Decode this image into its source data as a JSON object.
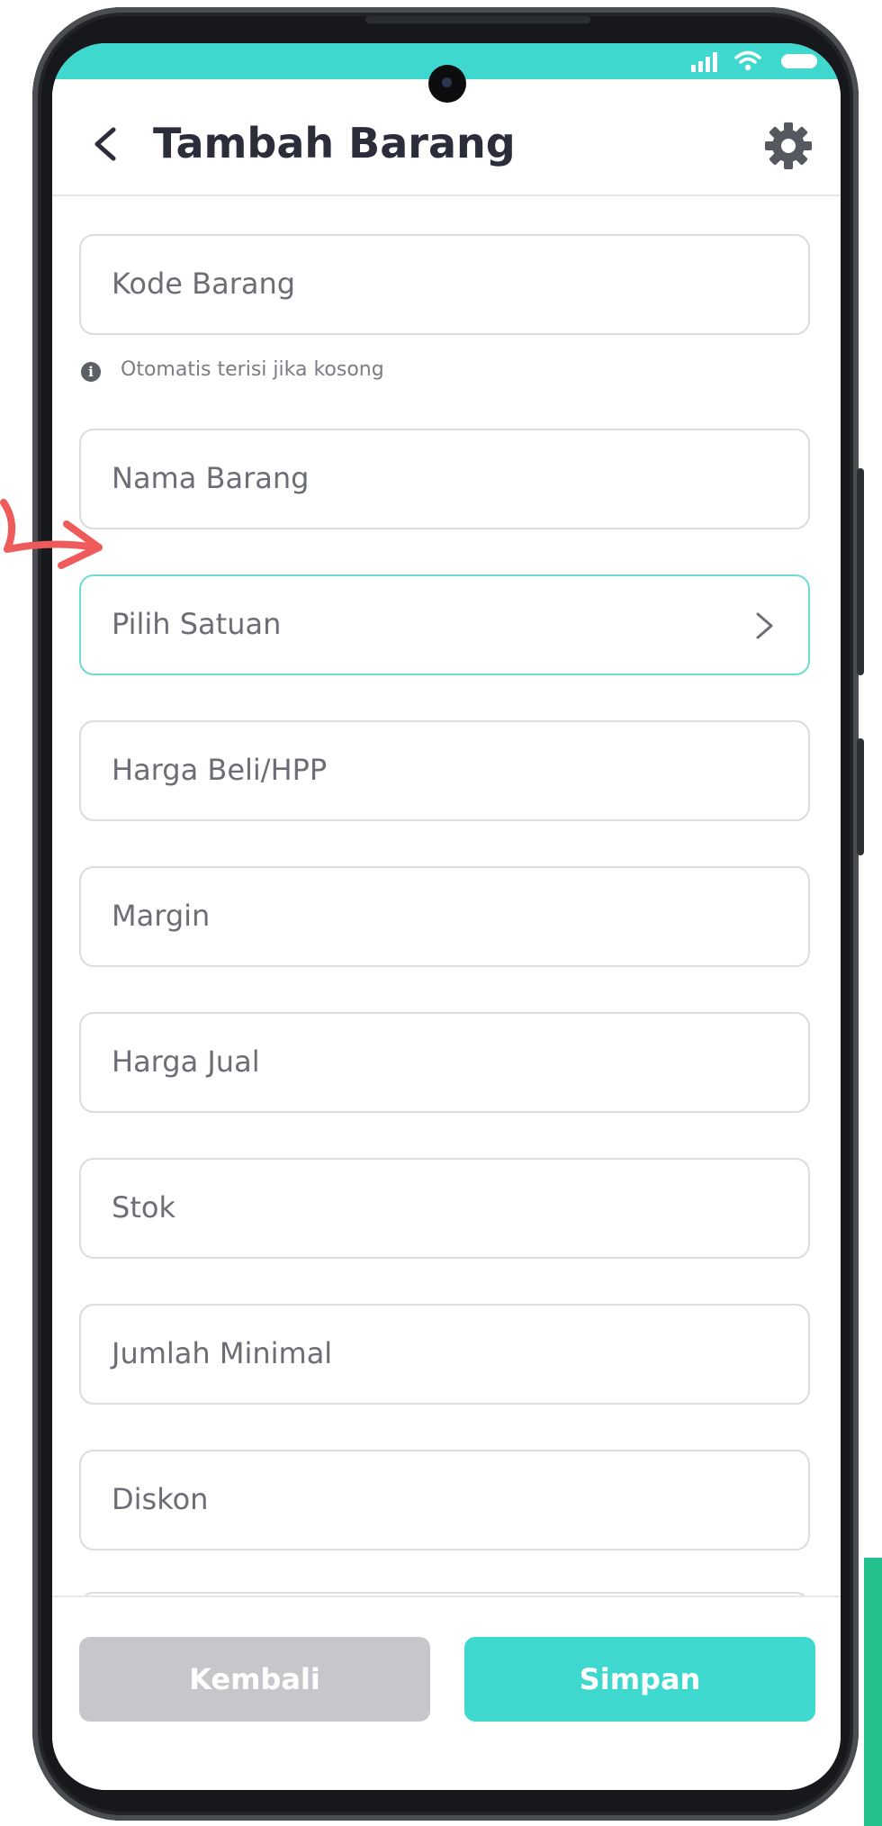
{
  "header": {
    "title": "Tambah Barang"
  },
  "fields": [
    {
      "placeholder": "Kode Barang"
    },
    {
      "placeholder": "Nama Barang"
    },
    {
      "placeholder": "Pilih Satuan"
    },
    {
      "placeholder": "Harga Beli/HPP"
    },
    {
      "placeholder": "Margin"
    },
    {
      "placeholder": "Harga Jual"
    },
    {
      "placeholder": "Stok"
    },
    {
      "placeholder": "Jumlah Minimal"
    },
    {
      "placeholder": "Diskon"
    }
  ],
  "hint": {
    "text": "Otomatis terisi jika kosong"
  },
  "footer": {
    "back_label": "Kembali",
    "save_label": "Simpan"
  },
  "colors": {
    "accent": "#3fd8cf",
    "disabled_button": "#c6c7ca",
    "annotation_arrow": "#ef5a5a",
    "corner_green": "#22c08d"
  },
  "icons": {
    "back": "chevron-left-icon",
    "settings": "gear-icon",
    "select": "chevron-right-icon",
    "hint": "info-icon"
  }
}
